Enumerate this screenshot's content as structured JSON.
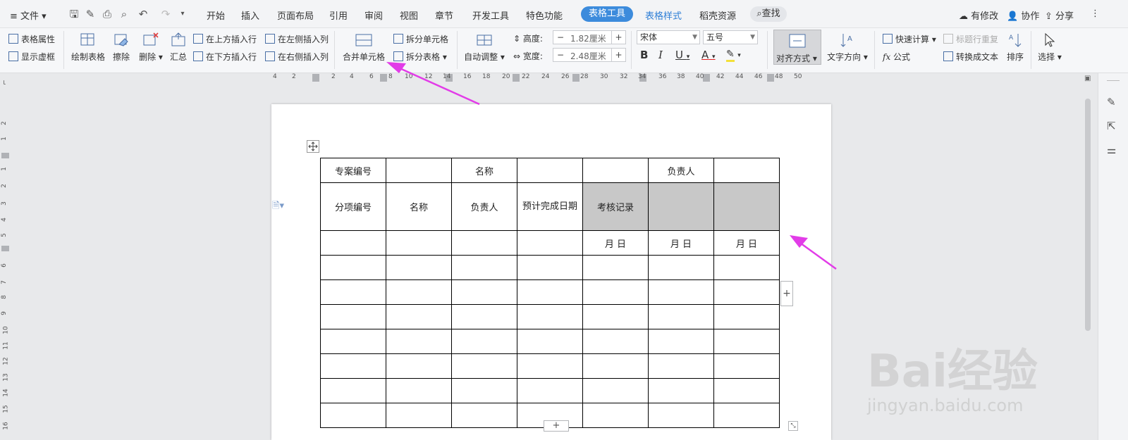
{
  "menubar": {
    "file_label": "文件",
    "tabs": [
      "开始",
      "插入",
      "页面布局",
      "引用",
      "审阅",
      "视图",
      "章节",
      "开发工具",
      "特色功能"
    ],
    "table_tools": "表格工具",
    "table_style": "表格样式",
    "resources": "稻壳资源",
    "search": "查找",
    "modified": "有修改",
    "collab": "协作",
    "share": "分享"
  },
  "ribbon": {
    "table_props": "表格属性",
    "show_gridlines": "显示虚框",
    "draw_table": "绘制表格",
    "erase": "擦除",
    "delete": "删除",
    "summary": "汇总",
    "insert_above": "在上方插入行",
    "insert_below": "在下方插入行",
    "insert_left": "在左侧插入列",
    "insert_right": "在右侧插入列",
    "merge_cells": "合并单元格",
    "split_cells": "拆分单元格",
    "split_table": "拆分表格",
    "auto_fit": "自动调整",
    "height_label": "高度:",
    "height_value": "1.82厘米",
    "width_label": "宽度:",
    "width_value": "2.48厘米",
    "font_name": "宋体",
    "font_size": "五号",
    "align": "对齐方式",
    "text_direction": "文字方向",
    "quick_calc": "快速计算",
    "repeat_header": "标题行重复",
    "formula": "公式",
    "convert_text": "转换成文本",
    "sort": "排序",
    "select": "选择",
    "bold": "B",
    "italic": "I",
    "underline": "U",
    "font_color": "A",
    "minus": "−",
    "plus": "+"
  },
  "ruler": {
    "h_ticks": [
      "4",
      "2",
      "2",
      "4",
      "6",
      "8",
      "10",
      "12",
      "14",
      "16",
      "18",
      "20",
      "22",
      "24",
      "26",
      "28",
      "30",
      "32",
      "34",
      "36",
      "38",
      "40",
      "42",
      "44",
      "46",
      "48",
      "50"
    ],
    "v_ticks": [
      "2",
      "1",
      "1",
      "2",
      "3",
      "4",
      "5",
      "6",
      "7",
      "8",
      "9",
      "10",
      "11",
      "12",
      "13",
      "14",
      "15",
      "16"
    ]
  },
  "table": {
    "rows": [
      [
        "专案编号",
        "",
        "名称",
        "",
        "",
        "负责人",
        ""
      ],
      [
        "分项编号",
        "名称",
        "负责人",
        "预计完成日期",
        "考核记录",
        "",
        ""
      ],
      [
        "",
        "",
        "",
        "",
        "月  日",
        "月  日",
        "月  日"
      ],
      [
        "",
        "",
        "",
        "",
        "",
        "",
        ""
      ],
      [
        "",
        "",
        "",
        "",
        "",
        "",
        ""
      ],
      [
        "",
        "",
        "",
        "",
        "",
        "",
        ""
      ],
      [
        "",
        "",
        "",
        "",
        "",
        "",
        ""
      ],
      [
        "",
        "",
        "",
        "",
        "",
        "",
        ""
      ],
      [
        "",
        "",
        "",
        "",
        "",
        "",
        ""
      ],
      [
        "",
        "",
        "",
        "",
        "",
        "",
        ""
      ]
    ]
  },
  "watermark": {
    "logo": "Bai经验",
    "url": "jingyan.baidu.com"
  },
  "colors": {
    "accent": "#3c8bdc",
    "arrow": "#e23ce8",
    "selected_cell": "#c8c8c8"
  }
}
